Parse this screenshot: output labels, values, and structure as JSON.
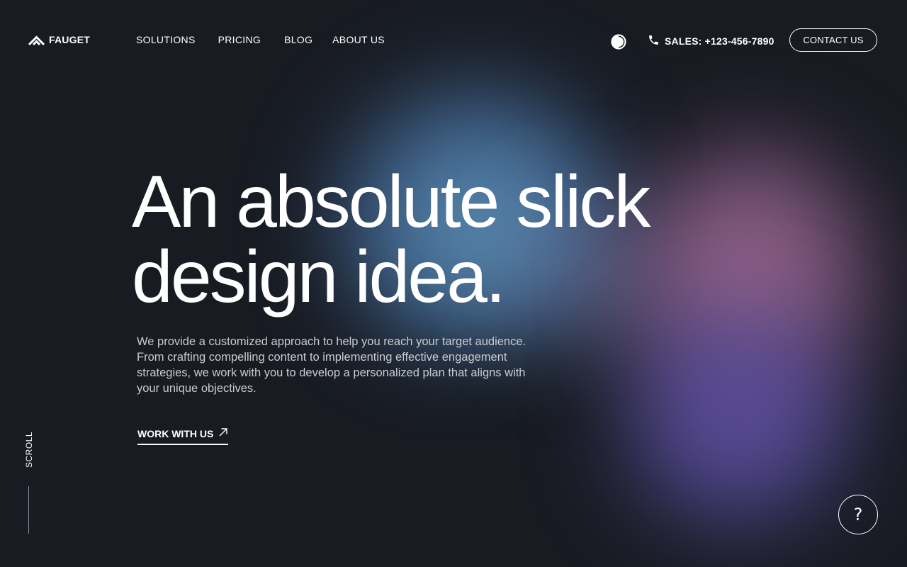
{
  "brand": {
    "name": "FAUGET",
    "logo_icon": "chevron-double-up-logo"
  },
  "nav": {
    "items": [
      "SOLUTIONS",
      "PRICING",
      "BLOG",
      "ABOUT US"
    ]
  },
  "header": {
    "theme_icon": "contrast-icon",
    "phone_icon": "phone-icon",
    "sales_label": "SALES: +123-456-7890",
    "contact_button": "CONTACT US"
  },
  "hero": {
    "title_line1": "An absolute slick",
    "title_line2": "design idea.",
    "description": "We provide a customized approach to help you reach your target audience. From crafting compelling content to implementing effective engagement strategies, we work with you to develop a personalized plan that aligns with your unique objectives.",
    "cta_label": "WORK WITH US",
    "cta_icon": "arrow-up-right-icon"
  },
  "scroll": {
    "label": "SCROLL"
  },
  "help": {
    "label": "?"
  },
  "colors": {
    "background": "#181b22",
    "text": "#ffffff",
    "muted_text": "#c9cbd1",
    "blob_blue": "#6eaac8",
    "blob_pink": "#aa6e96",
    "blob_purple": "#6450aa"
  }
}
